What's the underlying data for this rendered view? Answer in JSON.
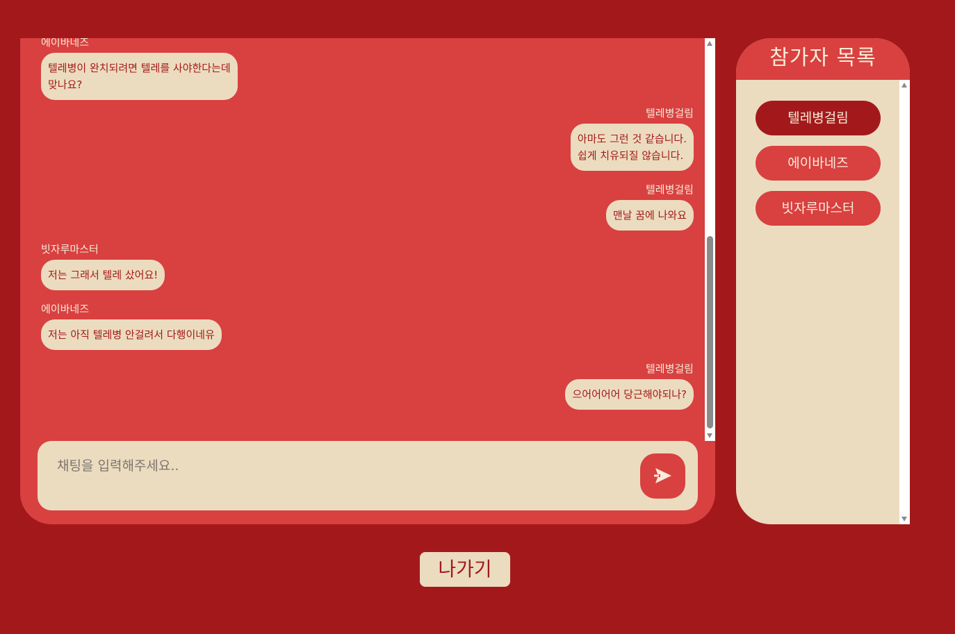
{
  "chat": {
    "messages": [
      {
        "side": "left",
        "sender": "에이바네즈",
        "text": [
          "텔레병이 완치되려면 텔레를 사야한다는데",
          "맞나요?"
        ]
      },
      {
        "side": "right",
        "sender": "텔레병걸림",
        "text": [
          "아마도 그런 것 같습니다.",
          "쉽게 치유되질 않습니다."
        ]
      },
      {
        "side": "right",
        "sender": "텔레병걸림",
        "text": [
          "맨날 꿈에 나와요"
        ]
      },
      {
        "side": "left",
        "sender": "빗자루마스터",
        "text": [
          "저는 그래서 텔레 샀어요!"
        ]
      },
      {
        "side": "left",
        "sender": "에이바네즈",
        "text": [
          "저는 아직 텔레병 안걸려서 다행이네유"
        ]
      },
      {
        "side": "right",
        "sender": "텔레병걸림",
        "text": [
          "으어어어어 당근해야되나?"
        ]
      }
    ],
    "input_placeholder": "채팅을 입력해주세요..",
    "input_value": ""
  },
  "participants": {
    "title": "참가자 목록",
    "items": [
      {
        "name": "텔레병걸림",
        "active": true
      },
      {
        "name": "에이바네즈",
        "active": false
      },
      {
        "name": "빗자루마스터",
        "active": false
      }
    ]
  },
  "exit_label": "나가기",
  "colors": {
    "background": "#a3191b",
    "panel": "#d94040",
    "bubble": "#ecdcbf",
    "text_dark": "#a3191b",
    "text_light": "#f7ecd9"
  },
  "icons": {
    "send": "send-arrow-icon"
  }
}
